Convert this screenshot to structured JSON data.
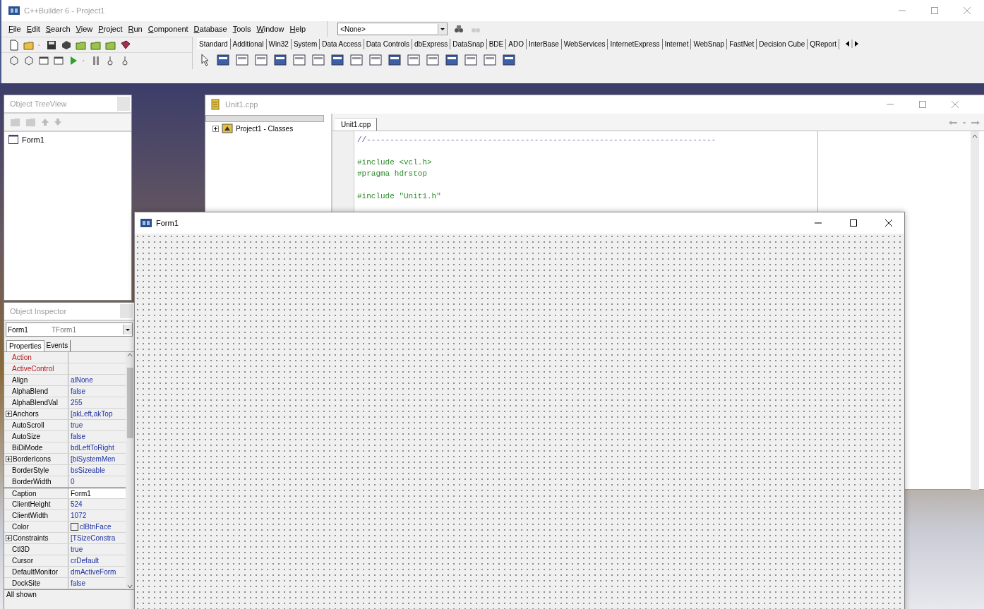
{
  "ide": {
    "title": "C++Builder 6 - Project1",
    "menu": [
      "File",
      "Edit",
      "Search",
      "View",
      "Project",
      "Run",
      "Component",
      "Database",
      "Tools",
      "Window",
      "Help"
    ],
    "target_combo": "<None>",
    "palette_tabs": [
      {
        "label": "Standard",
        "selected": true
      },
      {
        "label": "Additional",
        "selected": false
      },
      {
        "label": "Win32",
        "selected": false
      },
      {
        "label": "System",
        "selected": false
      },
      {
        "label": "Data Access",
        "selected": false
      },
      {
        "label": "Data Controls",
        "selected": false
      },
      {
        "label": "dbExpress",
        "selected": false
      },
      {
        "label": "DataSnap",
        "selected": false
      },
      {
        "label": "BDE",
        "selected": false
      },
      {
        "label": "ADO",
        "selected": false
      },
      {
        "label": "InterBase",
        "selected": false
      },
      {
        "label": "WebServices",
        "selected": false
      },
      {
        "label": "InternetExpress",
        "selected": false
      },
      {
        "label": "Internet",
        "selected": false
      },
      {
        "label": "WebSnap",
        "selected": false
      },
      {
        "label": "FastNet",
        "selected": false
      },
      {
        "label": "Decision Cube",
        "selected": false
      },
      {
        "label": "QReport",
        "selected": false
      }
    ]
  },
  "tree_view": {
    "title": "Object TreeView",
    "items": [
      {
        "label": "Form1"
      }
    ]
  },
  "inspector": {
    "title": "Object Inspector",
    "object_name": "Form1",
    "object_type": "TForm1",
    "tabs": [
      {
        "label": "Properties",
        "selected": true
      },
      {
        "label": "Events",
        "selected": false
      }
    ],
    "properties": [
      {
        "name": "Action",
        "kind": "reference",
        "expandable": false,
        "selected": false
      },
      {
        "name": "ActiveControl",
        "kind": "reference",
        "expandable": false,
        "selected": false
      },
      {
        "name": "Align",
        "value": "alNone",
        "kind": "plain",
        "expandable": false,
        "selected": false
      },
      {
        "name": "AlphaBlend",
        "value": "false",
        "kind": "plain",
        "expandable": false,
        "selected": false
      },
      {
        "name": "AlphaBlendVal",
        "value": "255",
        "kind": "plain",
        "expandable": false,
        "selected": false
      },
      {
        "name": "Anchors",
        "value": "[akLeft,akTop",
        "kind": "plain",
        "expandable": true,
        "selected": false
      },
      {
        "name": "AutoScroll",
        "value": "true",
        "kind": "plain",
        "expandable": false,
        "selected": false
      },
      {
        "name": "AutoSize",
        "value": "false",
        "kind": "plain",
        "expandable": false,
        "selected": false
      },
      {
        "name": "BiDiMode",
        "value": "bdLeftToRight",
        "kind": "plain",
        "expandable": false,
        "selected": false
      },
      {
        "name": "BorderIcons",
        "value": "[biSystemMen",
        "kind": "plain",
        "expandable": true,
        "selected": false
      },
      {
        "name": "BorderStyle",
        "value": "bsSizeable",
        "kind": "plain",
        "expandable": false,
        "selected": false
      },
      {
        "name": "BorderWidth",
        "value": "0",
        "kind": "plain",
        "expandable": false,
        "selected": false
      },
      {
        "name": "Caption",
        "value": "Form1",
        "kind": "plain",
        "expandable": false,
        "selected": true
      },
      {
        "name": "ClientHeight",
        "value": "524",
        "kind": "plain",
        "expandable": false,
        "selected": false
      },
      {
        "name": "ClientWidth",
        "value": "1072",
        "kind": "plain",
        "expandable": false,
        "selected": false
      },
      {
        "name": "Color",
        "value": "clBtnFace",
        "kind": "color",
        "expandable": false,
        "selected": false
      },
      {
        "name": "Constraints",
        "value": "[TSizeConstra",
        "kind": "plain",
        "expandable": true,
        "selected": false
      },
      {
        "name": "Ctl3D",
        "value": "true",
        "kind": "plain",
        "expandable": false,
        "selected": false
      },
      {
        "name": "Cursor",
        "value": "crDefault",
        "kind": "plain",
        "expandable": false,
        "selected": false
      },
      {
        "name": "DefaultMonitor",
        "value": "dmActiveForm",
        "kind": "plain",
        "expandable": false,
        "selected": false
      },
      {
        "name": "DockSite",
        "value": "false",
        "kind": "plain",
        "expandable": false,
        "selected": false
      }
    ],
    "status": "All shown"
  },
  "editor": {
    "title": "Unit1.cpp",
    "class_tree": [
      {
        "label": "Project1 - Classes",
        "expanded": false
      }
    ],
    "tabs": [
      {
        "label": "Unit1.cpp",
        "selected": true
      }
    ],
    "lines": [
      {
        "kind": "comment",
        "text": "//---------------------------------------------------------------------------"
      },
      {
        "kind": "blank"
      },
      {
        "kind": "directive",
        "text": "#include <vcl.h>"
      },
      {
        "kind": "directive",
        "text": "#pragma hdrstop"
      },
      {
        "kind": "blank"
      },
      {
        "kind": "directive",
        "text": "#include \"Unit1.h\""
      }
    ]
  },
  "form": {
    "title": "Form1"
  }
}
